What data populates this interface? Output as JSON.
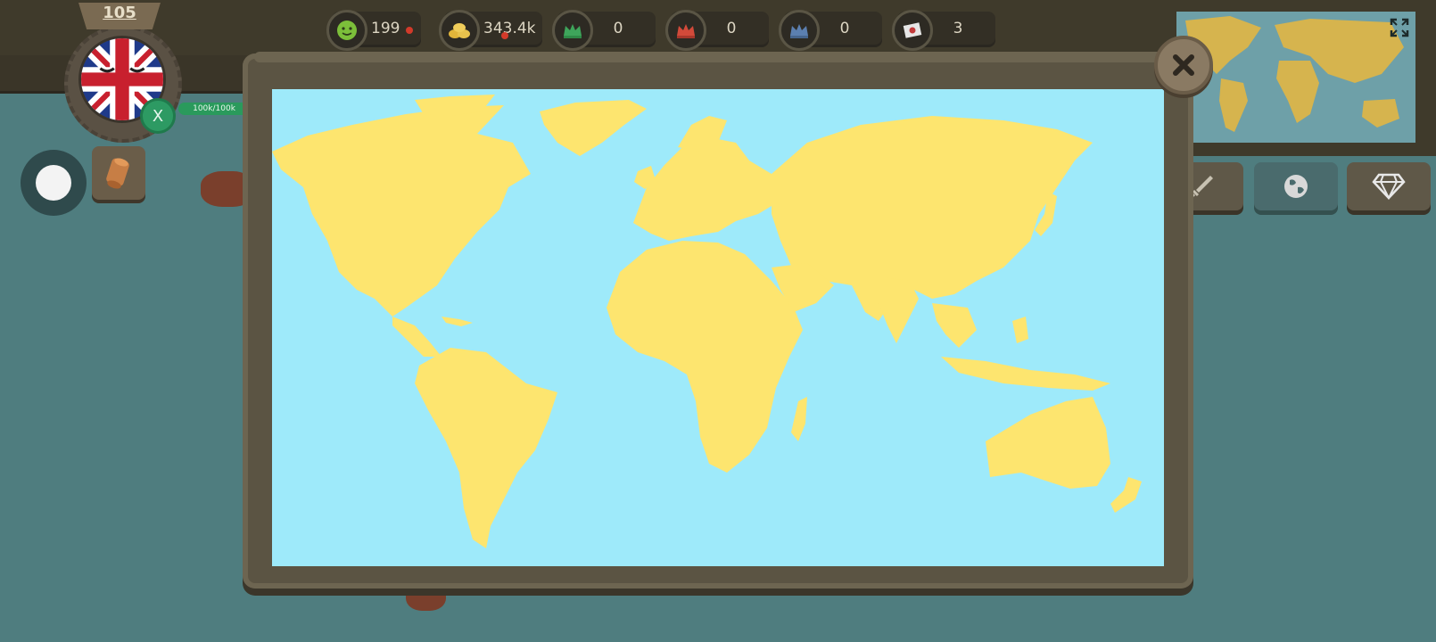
{
  "player": {
    "level": "105",
    "badge_label": "X",
    "health_text": "100k/100k"
  },
  "resources": [
    {
      "id": "population",
      "icon": "smiley-face-icon",
      "value": "199",
      "color": "#7cbf3a"
    },
    {
      "id": "gold",
      "icon": "gold-coins-icon",
      "value": "343.4k",
      "color": "#e2b53a"
    },
    {
      "id": "allies",
      "icon": "green-crown-icon",
      "value": "0",
      "color": "#3ea55b"
    },
    {
      "id": "enemies",
      "icon": "red-crown-icon",
      "value": "0",
      "color": "#d24a3a"
    },
    {
      "id": "neutral",
      "icon": "blue-crown-icon",
      "value": "0",
      "color": "#5b7fb0"
    },
    {
      "id": "flags",
      "icon": "flag-icon",
      "value": "3",
      "color": "#d9d9d9"
    }
  ],
  "colors": {
    "ocean": "#9eeafa",
    "land": "#fde56f",
    "panel": "#5b5443",
    "minimap_land": "#d6b44e",
    "minimap_water": "#6ea0a8"
  },
  "buttons": {
    "close": "close-icon",
    "fullscreen": "fullscreen-icon",
    "side": [
      "sword-icon",
      "globe-icon",
      "diamond-icon"
    ],
    "scroll": "scroll-icon"
  }
}
